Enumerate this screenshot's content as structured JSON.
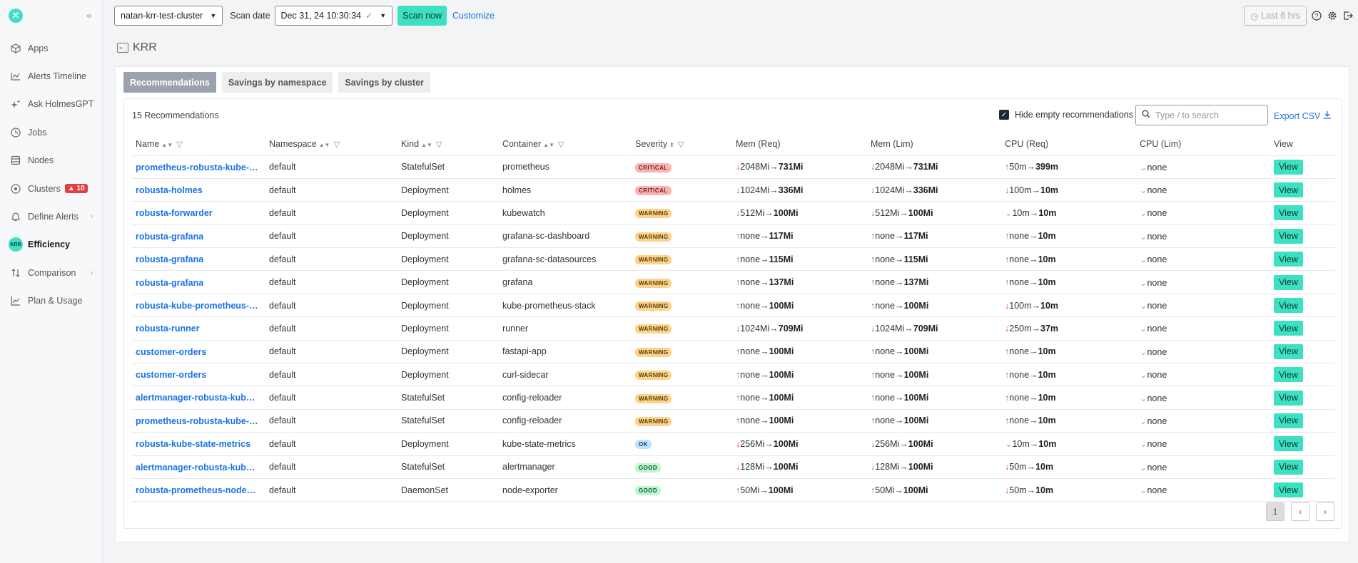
{
  "sidebar": {
    "collapse_icon": "«",
    "items": [
      {
        "label": "Apps",
        "icon": "cube-icon"
      },
      {
        "label": "Alerts Timeline",
        "icon": "timeline-icon"
      },
      {
        "label": "Ask HolmesGPT",
        "icon": "sparkle-icon"
      },
      {
        "label": "Jobs",
        "icon": "clock-icon"
      },
      {
        "label": "Nodes",
        "icon": "server-icon"
      },
      {
        "label": "Clusters",
        "icon": "clusters-icon",
        "badge": "10"
      },
      {
        "label": "Define Alerts",
        "icon": "bell-icon"
      },
      {
        "label": "Efficiency",
        "icon": "krr-icon",
        "krr_text": "KRR"
      },
      {
        "label": "Comparison",
        "icon": "compare-icon"
      },
      {
        "label": "Plan & Usage",
        "icon": "usage-icon"
      }
    ]
  },
  "topbar": {
    "cluster": "natan-krr-test-cluster",
    "scan_date_label": "Scan date",
    "scan_date": "Dec 31, 24 10:30:34",
    "scan_now": "Scan now",
    "customize": "Customize",
    "last_hrs": "Last 6 hrs"
  },
  "page": {
    "title": "KRR"
  },
  "tabs": [
    "Recommendations",
    "Savings by namespace",
    "Savings by cluster"
  ],
  "toolbar": {
    "count": "15 Recommendations",
    "hide_empty": "Hide empty recommendations",
    "search_placeholder": "Type / to search",
    "export": "Export CSV"
  },
  "table": {
    "headers": {
      "name": "Name",
      "namespace": "Namespace",
      "kind": "Kind",
      "container": "Container",
      "severity": "Severity",
      "mem_req": "Mem (Req)",
      "mem_lim": "Mem (Lim)",
      "cpu_req": "CPU (Req)",
      "cpu_lim": "CPU (Lim)",
      "view": "View"
    },
    "view_label": "View",
    "rows": [
      {
        "name": "prometheus-robusta-kube-pr...",
        "ns": "default",
        "kind": "StatefulSet",
        "container": "prometheus",
        "sev": "CRITICAL",
        "mr_dir": "down",
        "mr_from": "2048Mi",
        "mr_to": "731Mi",
        "ml_dir": "down",
        "ml_from": "2048Mi",
        "ml_to": "731Mi",
        "cr_dir": "up",
        "cr_from": "50m",
        "cr_to": "399m",
        "cl": "none"
      },
      {
        "name": "robusta-holmes",
        "ns": "default",
        "kind": "Deployment",
        "container": "holmes",
        "sev": "CRITICAL",
        "mr_dir": "down",
        "mr_from": "1024Mi",
        "mr_to": "336Mi",
        "ml_dir": "down",
        "ml_from": "1024Mi",
        "ml_to": "336Mi",
        "cr_dir": "down",
        "cr_from": "100m",
        "cr_to": "10m",
        "cl": "none"
      },
      {
        "name": "robusta-forwarder",
        "ns": "default",
        "kind": "Deployment",
        "container": "kubewatch",
        "sev": "WARNING",
        "mr_dir": "down",
        "mr_from": "512Mi",
        "mr_to": "100Mi",
        "ml_dir": "down",
        "ml_from": "512Mi",
        "ml_to": "100Mi",
        "cr_dir": "none",
        "cr_from": "10m",
        "cr_to": "10m",
        "cl": "none"
      },
      {
        "name": "robusta-grafana",
        "ns": "default",
        "kind": "Deployment",
        "container": "grafana-sc-dashboard",
        "sev": "WARNING",
        "mr_dir": "up",
        "mr_from": "none",
        "mr_to": "117Mi",
        "ml_dir": "up",
        "ml_from": "none",
        "ml_to": "117Mi",
        "cr_dir": "up",
        "cr_from": "none",
        "cr_to": "10m",
        "cl": "none"
      },
      {
        "name": "robusta-grafana",
        "ns": "default",
        "kind": "Deployment",
        "container": "grafana-sc-datasources",
        "sev": "WARNING",
        "mr_dir": "up",
        "mr_from": "none",
        "mr_to": "115Mi",
        "ml_dir": "up",
        "ml_from": "none",
        "ml_to": "115Mi",
        "cr_dir": "up",
        "cr_from": "none",
        "cr_to": "10m",
        "cl": "none"
      },
      {
        "name": "robusta-grafana",
        "ns": "default",
        "kind": "Deployment",
        "container": "grafana",
        "sev": "WARNING",
        "mr_dir": "up",
        "mr_from": "none",
        "mr_to": "137Mi",
        "ml_dir": "up",
        "ml_from": "none",
        "ml_to": "137Mi",
        "cr_dir": "up",
        "cr_from": "none",
        "cr_to": "10m",
        "cl": "none"
      },
      {
        "name": "robusta-kube-prometheus-st...",
        "ns": "default",
        "kind": "Deployment",
        "container": "kube-prometheus-stack",
        "sev": "WARNING",
        "mr_dir": "up",
        "mr_from": "none",
        "mr_to": "100Mi",
        "ml_dir": "up",
        "ml_from": "none",
        "ml_to": "100Mi",
        "cr_dir": "down",
        "cr_from": "100m",
        "cr_to": "10m",
        "cl": "none"
      },
      {
        "name": "robusta-runner",
        "ns": "default",
        "kind": "Deployment",
        "container": "runner",
        "sev": "WARNING",
        "mr_dir": "down",
        "mr_from": "1024Mi",
        "mr_to": "709Mi",
        "ml_dir": "down",
        "ml_from": "1024Mi",
        "ml_to": "709Mi",
        "cr_dir": "down",
        "cr_from": "250m",
        "cr_to": "37m",
        "cl": "none"
      },
      {
        "name": "customer-orders",
        "ns": "default",
        "kind": "Deployment",
        "container": "fastapi-app",
        "sev": "WARNING",
        "mr_dir": "up",
        "mr_from": "none",
        "mr_to": "100Mi",
        "ml_dir": "up",
        "ml_from": "none",
        "ml_to": "100Mi",
        "cr_dir": "up",
        "cr_from": "none",
        "cr_to": "10m",
        "cl": "none"
      },
      {
        "name": "customer-orders",
        "ns": "default",
        "kind": "Deployment",
        "container": "curl-sidecar",
        "sev": "WARNING",
        "mr_dir": "up",
        "mr_from": "none",
        "mr_to": "100Mi",
        "ml_dir": "up",
        "ml_from": "none",
        "ml_to": "100Mi",
        "cr_dir": "up",
        "cr_from": "none",
        "cr_to": "10m",
        "cl": "none"
      },
      {
        "name": "alertmanager-robusta-kube-...",
        "ns": "default",
        "kind": "StatefulSet",
        "container": "config-reloader",
        "sev": "WARNING",
        "mr_dir": "up",
        "mr_from": "none",
        "mr_to": "100Mi",
        "ml_dir": "up",
        "ml_from": "none",
        "ml_to": "100Mi",
        "cr_dir": "up",
        "cr_from": "none",
        "cr_to": "10m",
        "cl": "none"
      },
      {
        "name": "prometheus-robusta-kube-pr...",
        "ns": "default",
        "kind": "StatefulSet",
        "container": "config-reloader",
        "sev": "WARNING",
        "mr_dir": "up",
        "mr_from": "none",
        "mr_to": "100Mi",
        "ml_dir": "up",
        "ml_from": "none",
        "ml_to": "100Mi",
        "cr_dir": "up",
        "cr_from": "none",
        "cr_to": "10m",
        "cl": "none"
      },
      {
        "name": "robusta-kube-state-metrics",
        "ns": "default",
        "kind": "Deployment",
        "container": "kube-state-metrics",
        "sev": "OK",
        "mr_dir": "down",
        "mr_from": "256Mi",
        "mr_to": "100Mi",
        "ml_dir": "down",
        "ml_from": "256Mi",
        "ml_to": "100Mi",
        "cr_dir": "none",
        "cr_from": "10m",
        "cr_to": "10m",
        "cl": "none"
      },
      {
        "name": "alertmanager-robusta-kube-...",
        "ns": "default",
        "kind": "StatefulSet",
        "container": "alertmanager",
        "sev": "GOOD",
        "mr_dir": "down",
        "mr_from": "128Mi",
        "mr_to": "100Mi",
        "ml_dir": "down",
        "ml_from": "128Mi",
        "ml_to": "100Mi",
        "cr_dir": "down",
        "cr_from": "50m",
        "cr_to": "10m",
        "cl": "none"
      },
      {
        "name": "robusta-prometheus-node-e...",
        "ns": "default",
        "kind": "DaemonSet",
        "container": "node-exporter",
        "sev": "GOOD",
        "mr_dir": "up",
        "mr_from": "50Mi",
        "mr_to": "100Mi",
        "ml_dir": "up",
        "ml_from": "50Mi",
        "ml_to": "100Mi",
        "cr_dir": "down",
        "cr_from": "50m",
        "cr_to": "10m",
        "cl": "none"
      }
    ]
  },
  "pager": {
    "current": "1"
  },
  "colors": {
    "accent": "#3ee0c2",
    "link": "#1a73e8",
    "critical": "#f8b4b4",
    "warning": "#fbd38d",
    "ok": "#bfe3ff",
    "good": "#bbf7d0"
  }
}
